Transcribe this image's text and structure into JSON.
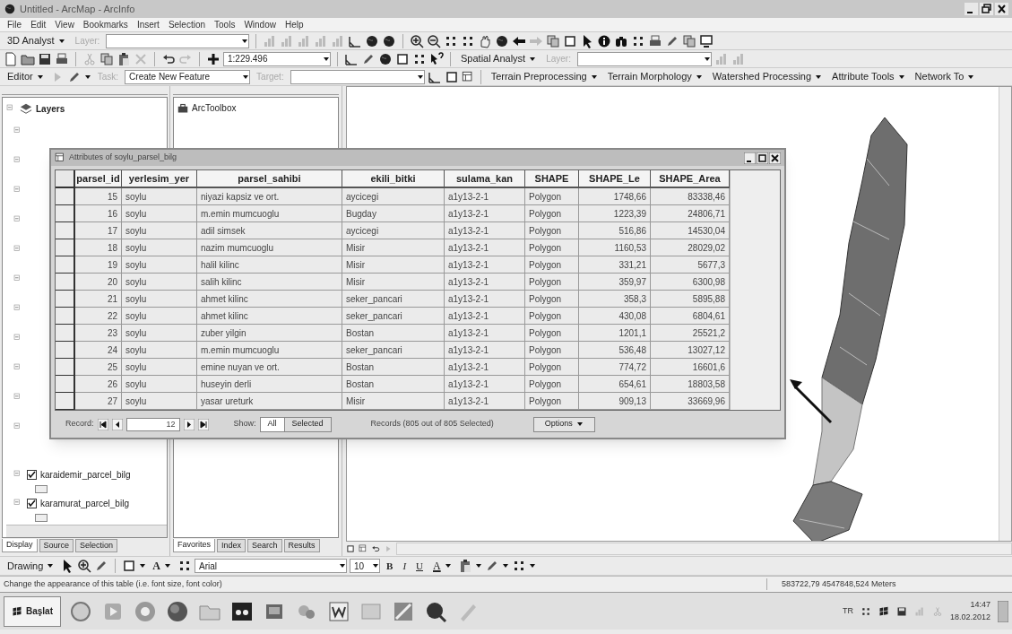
{
  "window": {
    "title": "Untitled - ArcMap - ArcInfo"
  },
  "menu": [
    "File",
    "Edit",
    "View",
    "Bookmarks",
    "Insert",
    "Selection",
    "Tools",
    "Window",
    "Help"
  ],
  "toolbar_3d": {
    "menu": "3D Analyst",
    "layer_label": {
      "text": "Layer:",
      "disabled": true
    }
  },
  "toolbar_standard": {
    "scale": "1:229.496",
    "spatial_menu": "Spatial Analyst",
    "layer_label": {
      "text": "Layer:",
      "disabled": true
    }
  },
  "toolbar_editor": {
    "menu": "Editor",
    "task_label": {
      "text": "Task:",
      "disabled": true
    },
    "task_value": "Create New Feature",
    "target_label": {
      "text": "Target:",
      "disabled": true
    },
    "menus": [
      "Terrain Preprocessing",
      "Terrain Morphology",
      "Watershed Processing",
      "Attribute Tools",
      "Network To"
    ]
  },
  "table_of_contents": {
    "root": "Layers",
    "layers": [
      {
        "name": "karaidemir_parcel_bilg",
        "checked": true
      },
      {
        "name": "karamurat_parcel_bilg",
        "checked": true
      }
    ],
    "tabs": [
      {
        "label": "Display",
        "selected": true
      },
      {
        "label": "Source",
        "selected": false
      },
      {
        "label": "Selection",
        "selected": false
      }
    ]
  },
  "toolbox": {
    "title": "ArcToolbox",
    "tabs": [
      {
        "label": "Favorites",
        "selected": true
      },
      {
        "label": "Index",
        "selected": false
      },
      {
        "label": "Search",
        "selected": false
      },
      {
        "label": "Results",
        "selected": false
      }
    ]
  },
  "attribute_table": {
    "title": "Attributes of soylu_parsel_bilg",
    "columns": [
      {
        "name": "parsel_id",
        "kind": "number"
      },
      {
        "name": "yerlesim_yer",
        "kind": "text"
      },
      {
        "name": "parsel_sahibi",
        "kind": "text"
      },
      {
        "name": "ekili_bitki",
        "kind": "text"
      },
      {
        "name": "sulama_kan",
        "kind": "text"
      },
      {
        "name": "SHAPE",
        "kind": "text"
      },
      {
        "name": "SHAPE_Le",
        "kind": "number"
      },
      {
        "name": "SHAPE_Area",
        "kind": "number"
      }
    ],
    "rows": [
      [
        "15",
        "soylu",
        "niyazi kapsiz ve ort.",
        "aycicegi",
        "a1y13-2-1",
        "Polygon",
        "1748,66",
        "83338,46"
      ],
      [
        "16",
        "soylu",
        "m.emin mumcuoglu",
        "Bugday",
        "a1y13-2-1",
        "Polygon",
        "1223,39",
        "24806,71"
      ],
      [
        "17",
        "soylu",
        "adil simsek",
        "aycicegi",
        "a1y13-2-1",
        "Polygon",
        "516,86",
        "14530,04"
      ],
      [
        "18",
        "soylu",
        "nazim mumcuoglu",
        "Misir",
        "a1y13-2-1",
        "Polygon",
        "1160,53",
        "28029,02"
      ],
      [
        "19",
        "soylu",
        "halil kilinc",
        "Misir",
        "a1y13-2-1",
        "Polygon",
        "331,21",
        "5677,3"
      ],
      [
        "20",
        "soylu",
        "salih kilinc",
        "Misir",
        "a1y13-2-1",
        "Polygon",
        "359,97",
        "6300,98"
      ],
      [
        "21",
        "soylu",
        "ahmet kilinc",
        "seker_pancari",
        "a1y13-2-1",
        "Polygon",
        "358,3",
        "5895,88"
      ],
      [
        "22",
        "soylu",
        "ahmet kilinc",
        "seker_pancari",
        "a1y13-2-1",
        "Polygon",
        "430,08",
        "6804,61"
      ],
      [
        "23",
        "soylu",
        "zuber yilgin",
        "Bostan",
        "a1y13-2-1",
        "Polygon",
        "1201,1",
        "25521,2"
      ],
      [
        "24",
        "soylu",
        "m.emin mumcuoglu",
        "seker_pancari",
        "a1y13-2-1",
        "Polygon",
        "536,48",
        "13027,12"
      ],
      [
        "25",
        "soylu",
        "emine nuyan ve ort.",
        "Bostan",
        "a1y13-2-1",
        "Polygon",
        "774,72",
        "16601,6"
      ],
      [
        "26",
        "soylu",
        "huseyin derli",
        "Bostan",
        "a1y13-2-1",
        "Polygon",
        "654,61",
        "18803,58"
      ],
      [
        "27",
        "soylu",
        "yasar ureturk",
        "Misir",
        "a1y13-2-1",
        "Polygon",
        "909,13",
        "33669,96"
      ]
    ],
    "footer": {
      "record_label": "Record:",
      "record": "12",
      "show_label": "Show:",
      "show_buttons": [
        {
          "label": "All",
          "selected": true
        },
        {
          "label": "Selected",
          "selected": false
        }
      ],
      "summary": "Records (805 out of 805 Selected)",
      "options": "Options"
    }
  },
  "drawing_toolbar": {
    "menu": "Drawing",
    "text_tool": "A",
    "font": "Arial",
    "size": "10",
    "format_buttons": [
      "B",
      "I",
      "U"
    ],
    "font_color": "A"
  },
  "status_bar": {
    "message": "Change the appearance of this table (i.e. font size, font color)",
    "coordinates": "583722,79  4547848,524 Meters"
  },
  "taskbar": {
    "start": "Başlat",
    "language": "TR",
    "time": "14:47",
    "date": "18.02.2012"
  }
}
